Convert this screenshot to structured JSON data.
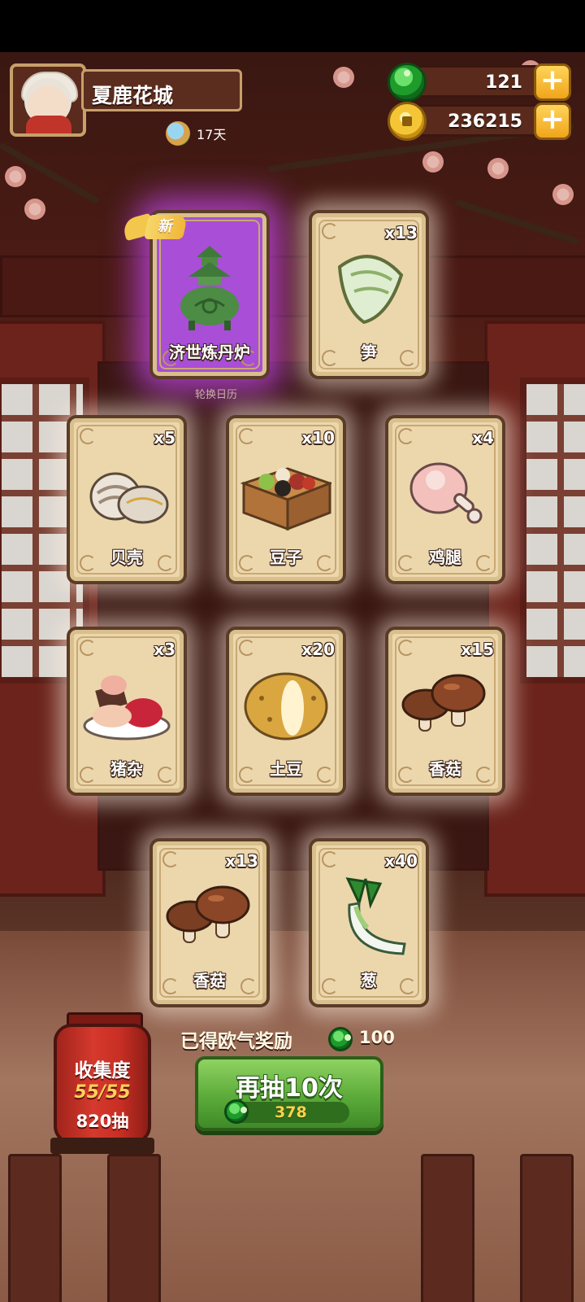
{
  "player": {
    "name": "夏鹿花城",
    "days": "17天"
  },
  "resources": {
    "jade": "121",
    "coins": "236215"
  },
  "new_badge": "新",
  "calendar_label": "轮换日历",
  "cards": [
    {
      "label": "济世炼丹炉",
      "count": "",
      "is_new": true,
      "icon": "alchemy-furnace-icon"
    },
    {
      "label": "笋",
      "count": "x13",
      "is_new": false,
      "icon": "bamboo-shoot-icon"
    },
    {
      "label": "贝壳",
      "count": "x5",
      "is_new": false,
      "icon": "shell-icon"
    },
    {
      "label": "豆子",
      "count": "x10",
      "is_new": false,
      "icon": "beans-icon"
    },
    {
      "label": "鸡腿",
      "count": "x4",
      "is_new": false,
      "icon": "chicken-leg-icon"
    },
    {
      "label": "猪杂",
      "count": "x3",
      "is_new": false,
      "icon": "pork-offal-icon"
    },
    {
      "label": "土豆",
      "count": "x20",
      "is_new": false,
      "icon": "potato-icon"
    },
    {
      "label": "香菇",
      "count": "x15",
      "is_new": false,
      "icon": "mushroom-icon"
    },
    {
      "label": "香菇",
      "count": "x13",
      "is_new": false,
      "icon": "mushroom-icon"
    },
    {
      "label": "葱",
      "count": "x40",
      "is_new": false,
      "icon": "scallion-icon"
    }
  ],
  "reward": {
    "label": "已得欧气奖励",
    "value": "100"
  },
  "draw_button": {
    "label": "再抽10次",
    "cost": "378"
  },
  "collection": {
    "title": "收集度",
    "progress": "55/55",
    "draws": "820抽"
  },
  "colors": {
    "card_bg": "#ecd7ad",
    "new_glow": "#be46e6",
    "button_green": "#5bab3a",
    "lantern_red": "#d6392d",
    "gold": "#ffd24a"
  }
}
